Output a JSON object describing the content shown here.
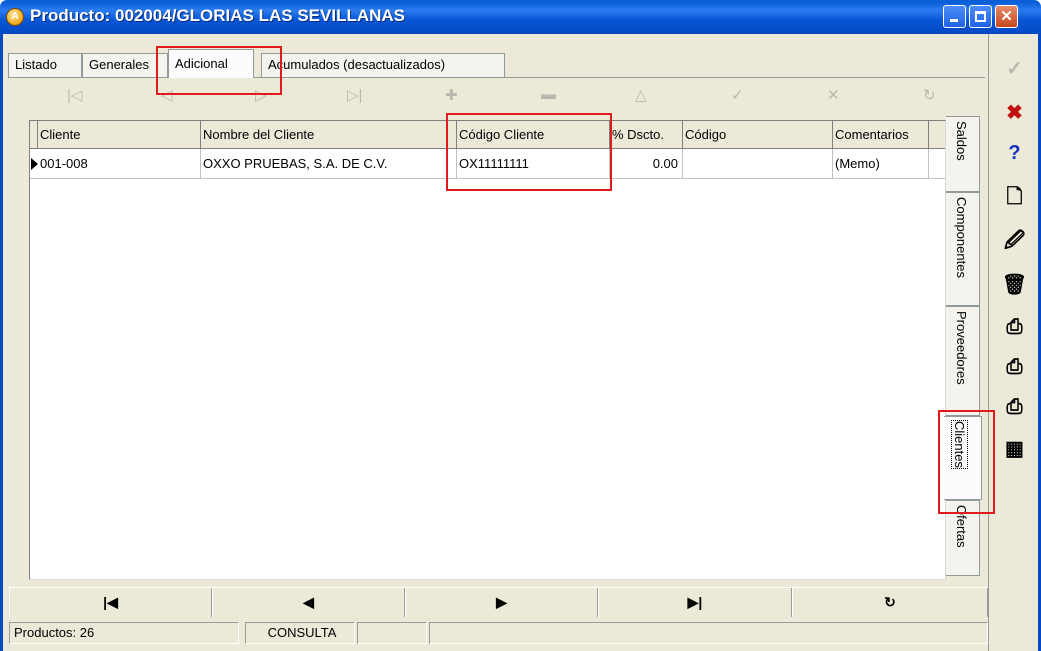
{
  "window": {
    "title": "Producto: 002004/GLORIAS LAS SEVILLANAS",
    "app_icon": "app-logo-icon",
    "colors": {
      "titlebar": "#0548c4",
      "annotation": "#e01b1b",
      "face": "#ece9d8"
    }
  },
  "tabs": [
    {
      "label": "Listado"
    },
    {
      "label": "Generales"
    },
    {
      "label": "Adicional",
      "active": true
    },
    {
      "label": "Acumulados (desactualizados)"
    }
  ],
  "record_nav_icons": [
    "first-icon",
    "prior-icon",
    "next-icon",
    "last-icon",
    "insert-icon",
    "delete-icon",
    "edit-icon",
    "post-icon",
    "cancel-icon",
    "refresh-icon"
  ],
  "grid": {
    "columns": [
      "Cliente",
      "Nombre del Cliente",
      "Código Cliente",
      "% Dscto.",
      "Código",
      "Comentarios"
    ],
    "rows": [
      {
        "cliente": "001-008",
        "nombre": "OXXO PRUEBAS, S.A. DE C.V.",
        "codigo_cliente": "OX11111111",
        "dscto": "0.00",
        "codigo": "",
        "comentarios": "(Memo)"
      }
    ]
  },
  "side_tabs": [
    {
      "label": "Saldos"
    },
    {
      "label": "Componentes"
    },
    {
      "label": "Proveedores"
    },
    {
      "label": "Clientes",
      "active": true
    },
    {
      "label": "Ofertas"
    }
  ],
  "bottom_nav": [
    "first-record-icon",
    "prior-record-icon",
    "next-record-icon",
    "last-record-icon",
    "refresh-icon"
  ],
  "status": {
    "productos": "Productos: 26",
    "mode": "CONSULTA",
    "extra1": "",
    "extra2": ""
  },
  "toolbar": [
    "check-icon",
    "cancel-x-icon",
    "help-icon",
    "new-doc-icon",
    "edit-doc-icon",
    "trash-icon",
    "print-icon",
    "print-preview-icon",
    "print-setup-icon",
    "calculator-icon"
  ]
}
